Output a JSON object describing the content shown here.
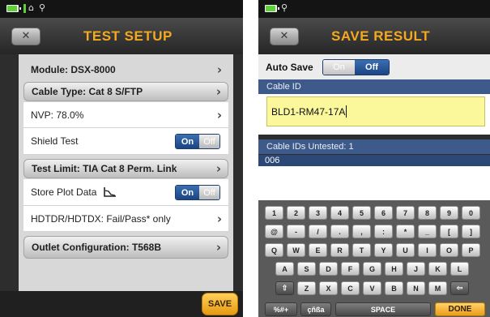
{
  "left": {
    "status_icons": [
      "battery-icon",
      "pin-icon",
      "signal-icon",
      "location-pin-icon"
    ],
    "title": "TEST SETUP",
    "rows": [
      {
        "label": "Module: DSX-8000",
        "style": "header",
        "chevron": true
      },
      {
        "label": "Cable Type: Cat 8 S/FTP",
        "style": "grey",
        "chevron": true
      },
      {
        "label": "NVP: 78.0%",
        "style": "white",
        "chevron": true
      },
      {
        "label": "Shield Test",
        "style": "white",
        "toggle": {
          "on": "On",
          "off": "Off",
          "state": "on"
        }
      },
      {
        "label": "Test Limit: TIA Cat 8 Perm. Link",
        "style": "grey",
        "chevron": true
      },
      {
        "label": "Store Plot Data",
        "style": "white",
        "toggle": {
          "on": "On",
          "off": "Off",
          "state": "on"
        },
        "icon": "plot-icon"
      },
      {
        "label": "HDTDR/HDTDX: Fail/Pass* only",
        "style": "white",
        "chevron": true
      },
      {
        "label": "Outlet Configuration: T568B",
        "style": "grey",
        "chevron": true
      }
    ],
    "save_label": "SAVE"
  },
  "right": {
    "title": "SAVE RESULT",
    "auto_save": {
      "label": "Auto Save",
      "on": "On",
      "off": "Off",
      "state": "off"
    },
    "cable_id_header": "Cable ID",
    "cable_id_value": "BLD1-RM47-17A",
    "untested_header": "Cable IDs Untested: 1",
    "untested_items": [
      "006"
    ],
    "keyboard": {
      "row1": [
        "1",
        "2",
        "3",
        "4",
        "5",
        "6",
        "7",
        "8",
        "9",
        "0"
      ],
      "row2": [
        "@",
        "-",
        "/",
        ".",
        ",",
        ":",
        "*",
        "_",
        "[",
        "]"
      ],
      "row3": [
        "Q",
        "W",
        "E",
        "R",
        "T",
        "Y",
        "U",
        "I",
        "O",
        "P"
      ],
      "row4": [
        "A",
        "S",
        "D",
        "F",
        "G",
        "H",
        "J",
        "K",
        "L"
      ],
      "row5": [
        "⇧",
        "Z",
        "X",
        "C",
        "V",
        "B",
        "N",
        "M",
        "⇦"
      ],
      "symbols": "%#+",
      "accents": "çñßa",
      "space": "SPACE",
      "done": "DONE"
    }
  },
  "colors": {
    "accent": "#f4a91e",
    "toggle_blue": "#1c4482",
    "field_yellow": "#fbf79b",
    "header_blue": "#3d5a8a"
  }
}
